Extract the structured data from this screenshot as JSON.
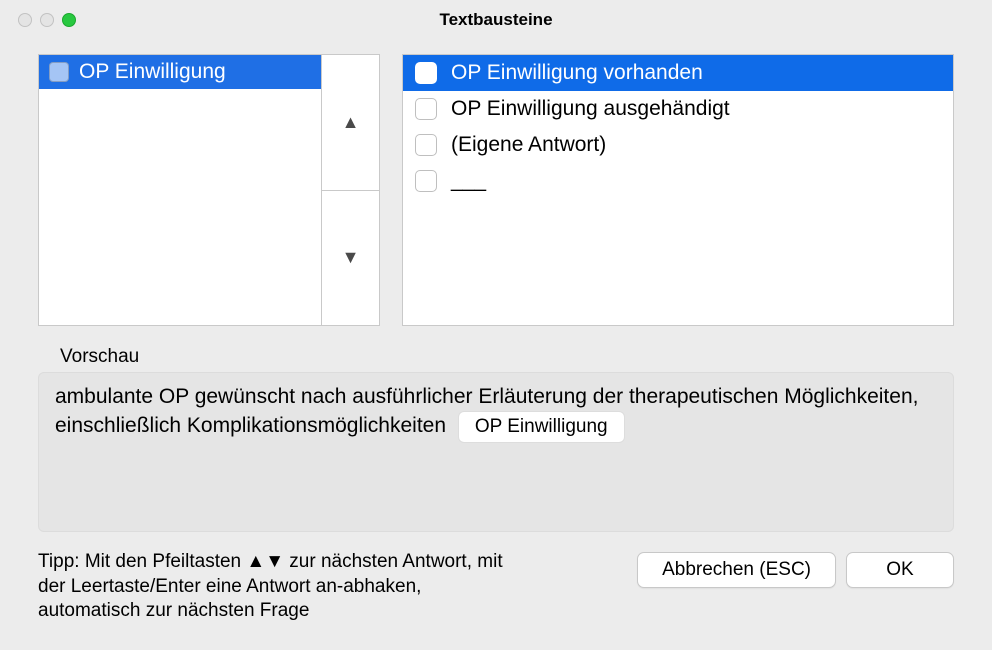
{
  "window": {
    "title": "Textbausteine"
  },
  "questions": [
    {
      "label": "OP Einwilligung",
      "selected": true
    }
  ],
  "answers": [
    {
      "label": "OP Einwilligung vorhanden",
      "selected": true
    },
    {
      "label": "OP Einwilligung ausgehändigt",
      "selected": false
    },
    {
      "label": "(Eigene Antwort)",
      "selected": false
    },
    {
      "label": "___",
      "selected": false
    }
  ],
  "preview": {
    "label": "Vorschau",
    "text": "ambulante OP gewünscht nach ausführlicher Erläuterung der therapeutischen Möglichkeiten, einschließlich Komplikationsmöglichkeiten",
    "tag": "OP Einwilligung"
  },
  "hint": "Tipp: Mit den Pfeiltasten ▲▼ zur nächsten Antwort, mit der Leertaste/Enter eine Antwort an-abhaken, automatisch zur nächsten Frage",
  "buttons": {
    "cancel": "Abbrechen (ESC)",
    "ok": "OK"
  }
}
